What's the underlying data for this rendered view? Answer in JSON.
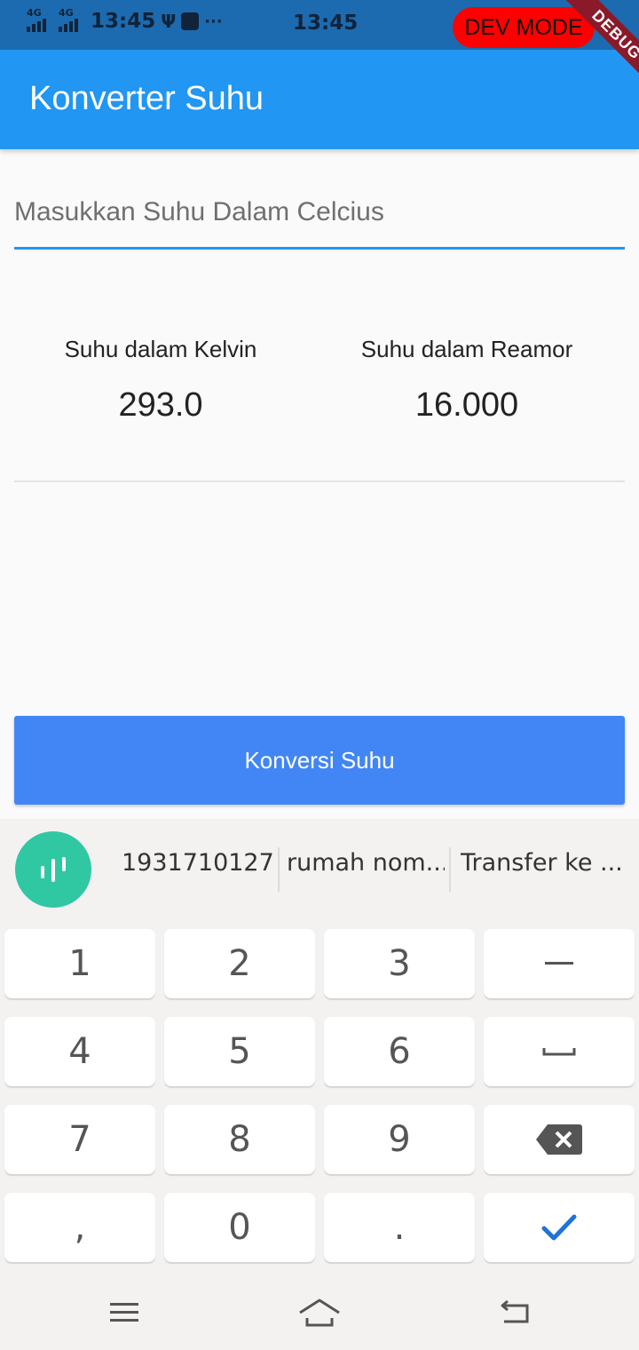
{
  "status_bar": {
    "network_1": "4G",
    "network_2": "4G",
    "time_left": "13:45",
    "more": "···",
    "time_center": "13:45",
    "dev_mode": "DEV MODE",
    "debug_ribbon": "DEBUG",
    "accent": "#1c6bb0"
  },
  "app_bar": {
    "title": "Konverter Suhu",
    "color": "#2196f3"
  },
  "input": {
    "placeholder": "Masukkan Suhu Dalam Celcius",
    "value": ""
  },
  "results": {
    "kelvin_label": "Suhu dalam Kelvin",
    "kelvin_value": "293.0",
    "reamor_label": "Suhu dalam Reamor",
    "reamor_value": "16.000"
  },
  "convert_button": {
    "label": "Konversi Suhu",
    "color": "#4286f5"
  },
  "keyboard": {
    "voice_icon": "voice-wave-icon",
    "suggestions": [
      "1931710127",
      "rumah nom...",
      "Transfer ke ..."
    ],
    "rows": [
      [
        "1",
        "2",
        "3",
        "–"
      ],
      [
        "4",
        "5",
        "6",
        "␣"
      ],
      [
        "7",
        "8",
        "9",
        "⌫"
      ],
      [
        ",",
        "0",
        ".",
        "✓"
      ]
    ]
  },
  "nav_bar": {
    "menu_icon": "menu-icon",
    "home_icon": "home-icon",
    "back_icon": "back-icon"
  }
}
